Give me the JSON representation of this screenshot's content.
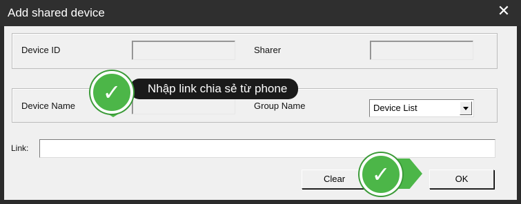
{
  "window": {
    "title": "Add shared device",
    "close_symbol": "✕"
  },
  "labels": {
    "device_id": "Device ID",
    "sharer": "Sharer",
    "device_name": "Device Name",
    "group_name": "Group Name",
    "link": "Link:"
  },
  "fields": {
    "device_id_value": "",
    "sharer_value": "",
    "device_name_value": "",
    "link_value": ""
  },
  "group_select": {
    "selected": "Device List"
  },
  "buttons": {
    "clear": "Clear",
    "ok": "OK"
  },
  "annotation": {
    "tooltip": "Nhập link chia sẻ từ phone",
    "check_symbol": "✓",
    "accent_color": "#4cb648"
  }
}
